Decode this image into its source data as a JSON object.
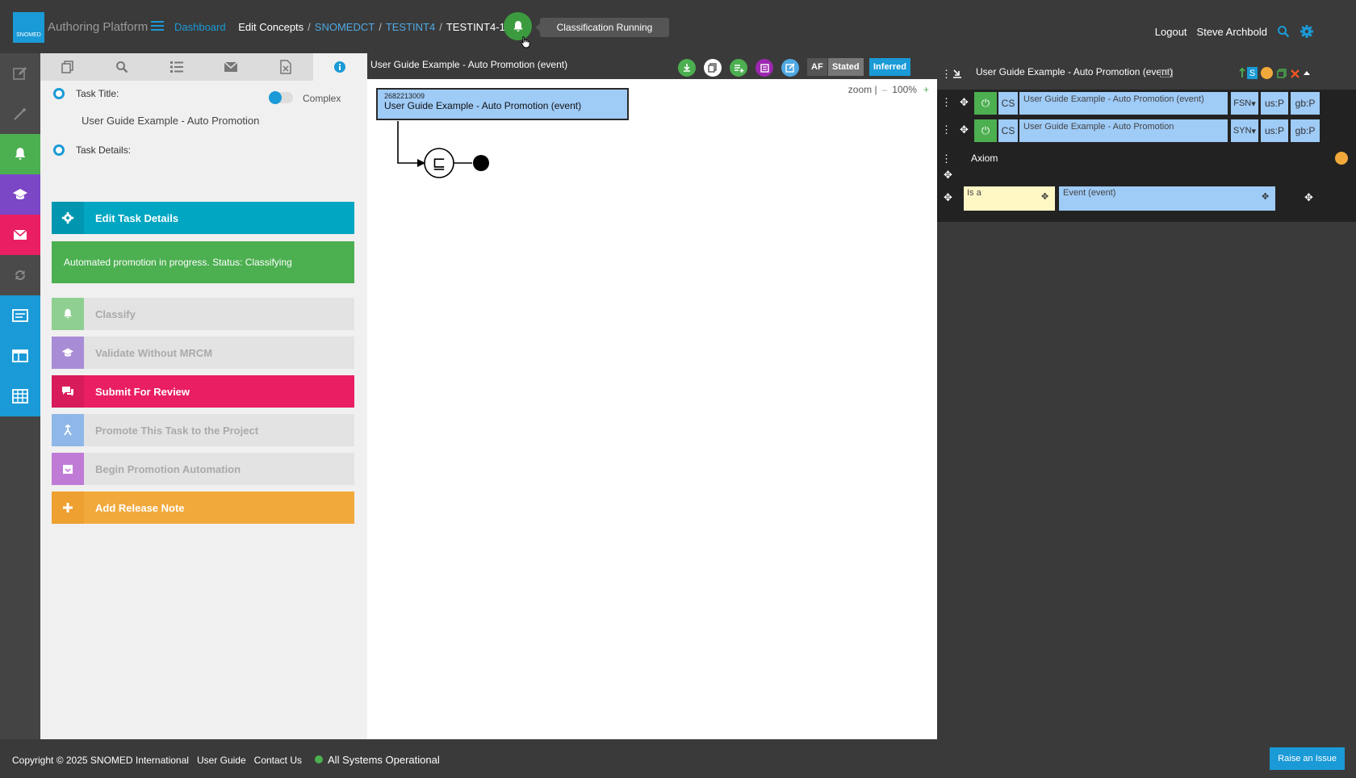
{
  "header": {
    "logo_text": "SNOMED",
    "app_title": "Authoring Platform",
    "breadcrumbs": {
      "dashboard": "Dashboard",
      "edit_concepts": "Edit Concepts",
      "codesystem": "SNOMEDCT",
      "project": "TESTINT4",
      "task": "TESTINT4-156"
    },
    "notification_tooltip": "Classification Running",
    "logout": "Logout",
    "user": "Steve Archbold"
  },
  "task_panel": {
    "task_title_label": "Task Title:",
    "complex_label": "Complex",
    "task_title_value": "User Guide Example - Auto Promotion",
    "task_details_label": "Task Details:",
    "edit_task_details": "Edit Task Details",
    "status_message": "Automated promotion in progress. Status: Classifying",
    "actions": {
      "classify": "Classify",
      "validate": "Validate Without MRCM",
      "submit": "Submit For Review",
      "promote": "Promote This Task to the Project",
      "automation": "Begin Promotion Automation",
      "release_note": "Add Release Note"
    }
  },
  "diagram": {
    "title": "User Guide Example - Auto Promotion (event)",
    "af": "AF",
    "stated": "Stated",
    "inferred": "Inferred",
    "zoom_label": "zoom |",
    "zoom_minus": "–",
    "zoom_value": "100%",
    "zoom_plus": "+",
    "concept_id": "2682213009",
    "concept_name": "User Guide Example - Auto Promotion (event)",
    "equiv_symbol": "⊑"
  },
  "concept_panel": {
    "title": "User Guide Example - Auto Promotion (event)",
    "s_badge": "S",
    "descriptions": [
      {
        "cs": "CS",
        "term": "User Guide Example - Auto Promotion (event)",
        "type": "FSN",
        "us": "us:P",
        "gb": "gb:P"
      },
      {
        "cs": "CS",
        "term": "User Guide Example - Auto Promotion",
        "type": "SYN",
        "us": "us:P",
        "gb": "gb:P"
      }
    ],
    "axiom_label": "Axiom",
    "relationship": {
      "type": "Is a",
      "target": "Event (event)"
    }
  },
  "footer": {
    "copyright": "Copyright © 2025 SNOMED International",
    "user_guide": "User Guide",
    "contact": "Contact Us",
    "system_status": "All Systems Operational",
    "raise_issue": "Raise an Issue"
  },
  "colors": {
    "accent": "#1a9ad6",
    "green": "#4caf50",
    "purple": "#7b47c7",
    "pink": "#e91e63",
    "orange": "#f2a93b",
    "concept_blue": "#9fcbf7"
  }
}
